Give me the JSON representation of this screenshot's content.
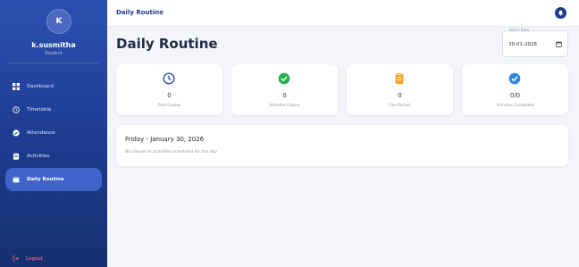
{
  "user": {
    "initial": "K",
    "name": "k.susmitha",
    "role": "Student"
  },
  "sidebar": {
    "items": [
      {
        "label": "Dashboard",
        "icon": "grid-icon",
        "active": false
      },
      {
        "label": "Timetable",
        "icon": "clock-icon",
        "active": false
      },
      {
        "label": "Attendance",
        "icon": "check-circle-icon",
        "active": false
      },
      {
        "label": "Activities",
        "icon": "clipboard-icon",
        "active": false
      },
      {
        "label": "Daily Routine",
        "icon": "calendar-icon",
        "active": true
      }
    ],
    "logout_label": "Logout"
  },
  "header": {
    "title": "Daily Routine"
  },
  "main": {
    "title": "Daily Routine",
    "date_picker": {
      "label": "Select Date",
      "value": "30-01-2026"
    },
    "stats": [
      {
        "value": "0",
        "label": "Total Classes",
        "icon": "clock-icon",
        "color": "#2f4fa8"
      },
      {
        "value": "0",
        "label": "Attended Classes",
        "icon": "check-circle-icon",
        "color": "#22b14c"
      },
      {
        "value": "0",
        "label": "Free Periods",
        "icon": "clipboard-icon",
        "color": "#f5a623"
      },
      {
        "value": "0/0",
        "label": "Activities Completed",
        "icon": "check-circle-icon",
        "color": "#2f86e0"
      }
    ],
    "day": {
      "title": "Friday - January 30, 2026",
      "message": "No classes or activities scheduled for this day"
    }
  },
  "colors": {
    "sidebar": "#1d3b8f",
    "accent": "#3f63c8",
    "background": "#f3f5fb",
    "logout": "#ff6b6b"
  }
}
